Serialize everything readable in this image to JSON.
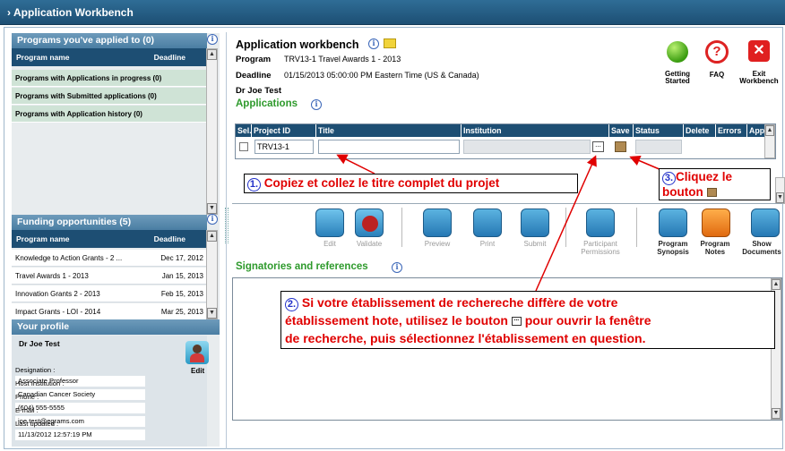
{
  "window": {
    "title": "Application Workbench"
  },
  "left": {
    "programs": {
      "header": "Programs you've applied to (0)",
      "col_name": "Program name",
      "col_deadline": "Deadline",
      "rows": [
        "Programs with Applications in progress (0)",
        "Programs with Submitted applications (0)",
        "Programs with Application history (0)"
      ]
    },
    "funding": {
      "header": "Funding opportunities (5)",
      "col_name": "Program name",
      "col_deadline": "Deadline",
      "rows": [
        {
          "name": "Knowledge to Action Grants - 2 ...",
          "date": "Dec 17, 2012"
        },
        {
          "name": "Travel Awards 1 - 2013",
          "date": "Jan 15, 2013"
        },
        {
          "name": "Innovation Grants 2 - 2013",
          "date": "Feb 15, 2013"
        },
        {
          "name": "Impact Grants - LOI - 2014",
          "date": "Mar 25, 2013"
        }
      ]
    },
    "profile": {
      "header": "Your profile",
      "name": "Dr Joe Test",
      "edit": "Edit",
      "fields": [
        {
          "label": "Designation :",
          "value": "Associate Professor"
        },
        {
          "label": "Host Institution :",
          "value": "Canadian Cancer Society"
        },
        {
          "label": "Phone :",
          "value": "(604) 555-5555"
        },
        {
          "label": "E-mail :",
          "value": "joe.test@egrams.com"
        },
        {
          "label": "Last updated :",
          "value": "11/13/2012 12:57:19 PM"
        }
      ]
    }
  },
  "main": {
    "title": "Application workbench",
    "program_label": "Program",
    "program_value": "TRV13-1  Travel Awards 1 - 2013",
    "deadline_label": "Deadline",
    "deadline_value": "01/15/2013 05:00:00 PM Eastern Time (US & Canada)",
    "user": "Dr Joe Test",
    "applications_label": "Applications",
    "top_buttons": [
      {
        "label": "Getting\nStarted"
      },
      {
        "label": "FAQ"
      },
      {
        "label": "Exit\nWorkbench"
      }
    ],
    "table": {
      "headers": [
        "Sel.",
        "Project ID",
        "Title",
        "Institution",
        "Save",
        "Status",
        "Delete",
        "Errors",
        "App."
      ],
      "row": {
        "project_id": "TRV13-1",
        "title": "",
        "institution": ""
      },
      "lookup_glyph": "..."
    },
    "toolbar": [
      {
        "label": "Edit"
      },
      {
        "label": "Validate"
      },
      {
        "label": "Preview"
      },
      {
        "label": "Print"
      },
      {
        "label": "Submit"
      },
      {
        "label": "Participant\nPermissions"
      },
      {
        "label": "Program\nSynopsis"
      },
      {
        "label": "Program\nNotes"
      },
      {
        "label": "Show\nDocuments"
      }
    ],
    "signatories_label": "Signatories and references"
  },
  "annotations": {
    "a1_num": "1.",
    "a1": "Copiez et collez le titre complet du projet",
    "a2_num": "2.",
    "a2_line1": "Si votre établissement de rechereche diffère de votre",
    "a2_line2_a": "établissement hote, utilisez le bouton",
    "a2_line2_b": "pour ouvrir la fenêtre",
    "a2_line3": "de recherche, puis sélectionnez l'établissement en question.",
    "a3_num": "3.",
    "a3_line1": "Cliquez le",
    "a3_line2": "bouton"
  },
  "colors": {
    "accent": "#1d4e73",
    "annotation_red": "#e00000",
    "annotation_blue": "#2230c9",
    "green": "#2e9a2c"
  }
}
